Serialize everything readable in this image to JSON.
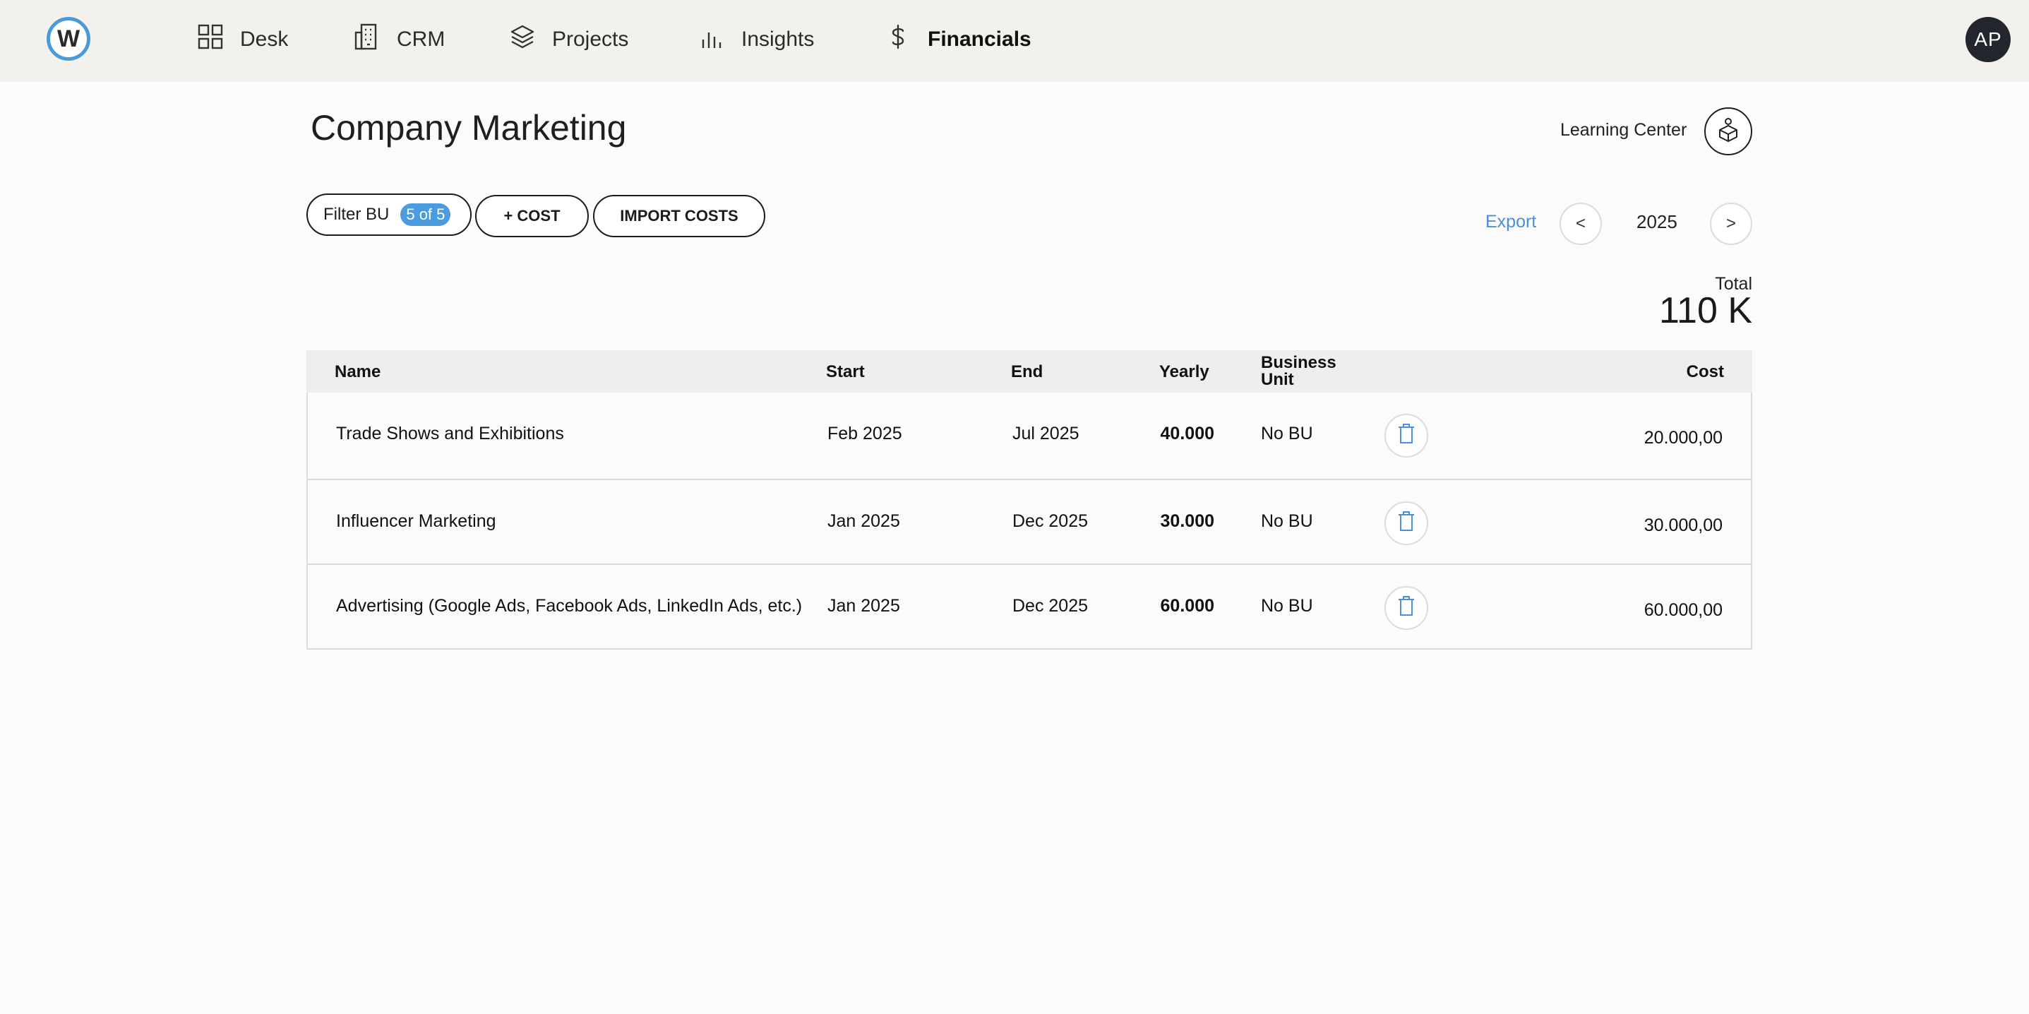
{
  "nav": {
    "logo_letter": "W",
    "items": [
      {
        "label": "Desk",
        "icon": "grid-icon"
      },
      {
        "label": "CRM",
        "icon": "building-icon"
      },
      {
        "label": "Projects",
        "icon": "layers-icon"
      },
      {
        "label": "Insights",
        "icon": "bar-chart-icon"
      },
      {
        "label": "Financials",
        "icon": "dollar-icon",
        "active": true
      }
    ],
    "avatar_initials": "AP"
  },
  "header": {
    "title": "Company Marketing",
    "learning_center": "Learning Center"
  },
  "actions": {
    "filter_label": "Filter BU",
    "filter_badge": "5 of 5",
    "add_cost": "+ COST",
    "import_costs": "IMPORT COSTS",
    "export": "Export",
    "prev": "<",
    "next": ">",
    "year": "2025"
  },
  "total": {
    "label": "Total",
    "value": "110 K"
  },
  "table": {
    "columns": {
      "name": "Name",
      "start": "Start",
      "end": "End",
      "yearly": "Yearly",
      "bu_line1": "Business",
      "bu_line2": "Unit",
      "cost": "Cost"
    },
    "rows": [
      {
        "name": "Trade Shows and Exhibitions",
        "start": "Feb 2025",
        "end": "Jul 2025",
        "yearly": "40.000",
        "bu": "No BU",
        "cost": "20.000,00"
      },
      {
        "name": "Influencer Marketing",
        "start": "Jan 2025",
        "end": "Dec 2025",
        "yearly": "30.000",
        "bu": "No BU",
        "cost": "30.000,00"
      },
      {
        "name": "Advertising (Google Ads, Facebook Ads, LinkedIn Ads, etc.)",
        "start": "Jan 2025",
        "end": "Dec 2025",
        "yearly": "60.000",
        "bu": "No BU",
        "cost": "60.000,00"
      }
    ]
  },
  "colors": {
    "accent": "#4a90d9",
    "topbar": "#f3f1ec",
    "avatar": "#23262c"
  }
}
